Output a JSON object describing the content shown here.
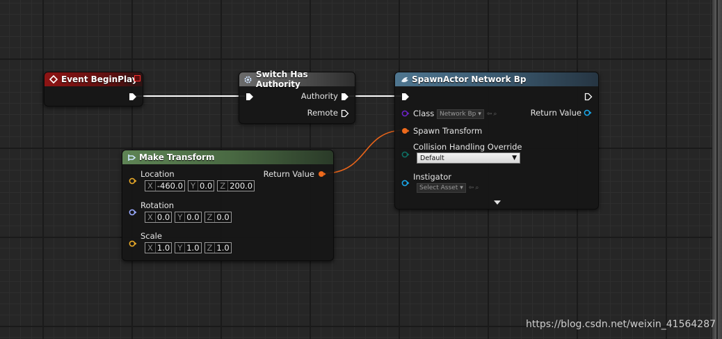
{
  "graph": {
    "watermark": "https://blog.csdn.net/weixin_41564287",
    "colors": {
      "event_header": "#8c1616",
      "function_header": "#3c5a6c",
      "pure_header": "#4a6a43",
      "exec_wire": "#ffffff",
      "transform_pin": "#ee6a1c",
      "class_pin": "#5b1aa6",
      "struct_pin": "#e8a928",
      "rotator_pin": "#99aaff",
      "object_pin": "#1aa6e8",
      "byte_pin": "#0e6e63"
    },
    "nodes": {
      "event": {
        "title": "Event BeginPlay"
      },
      "switch": {
        "title": "Switch Has Authority",
        "authority_label": "Authority",
        "remote_label": "Remote"
      },
      "spawn": {
        "title": "SpawnActor Network Bp",
        "class_label": "Class",
        "class_value": "Network Bp",
        "return_label": "Return Value",
        "spawn_transform_label": "Spawn Transform",
        "collision_label": "Collision Handling Override",
        "collision_value": "Default",
        "instigator_label": "Instigator",
        "instigator_value": "Select Asset"
      },
      "make_transform": {
        "title": "Make Transform",
        "return_label": "Return Value",
        "location_label": "Location",
        "rotation_label": "Rotation",
        "scale_label": "Scale",
        "axes": [
          "X",
          "Y",
          "Z"
        ],
        "location": [
          "-460.0",
          "0.0",
          "200.0"
        ],
        "rotation": [
          "0.0",
          "0.0",
          "0.0"
        ],
        "scale": [
          "1.0",
          "1.0",
          "1.0"
        ]
      }
    }
  }
}
